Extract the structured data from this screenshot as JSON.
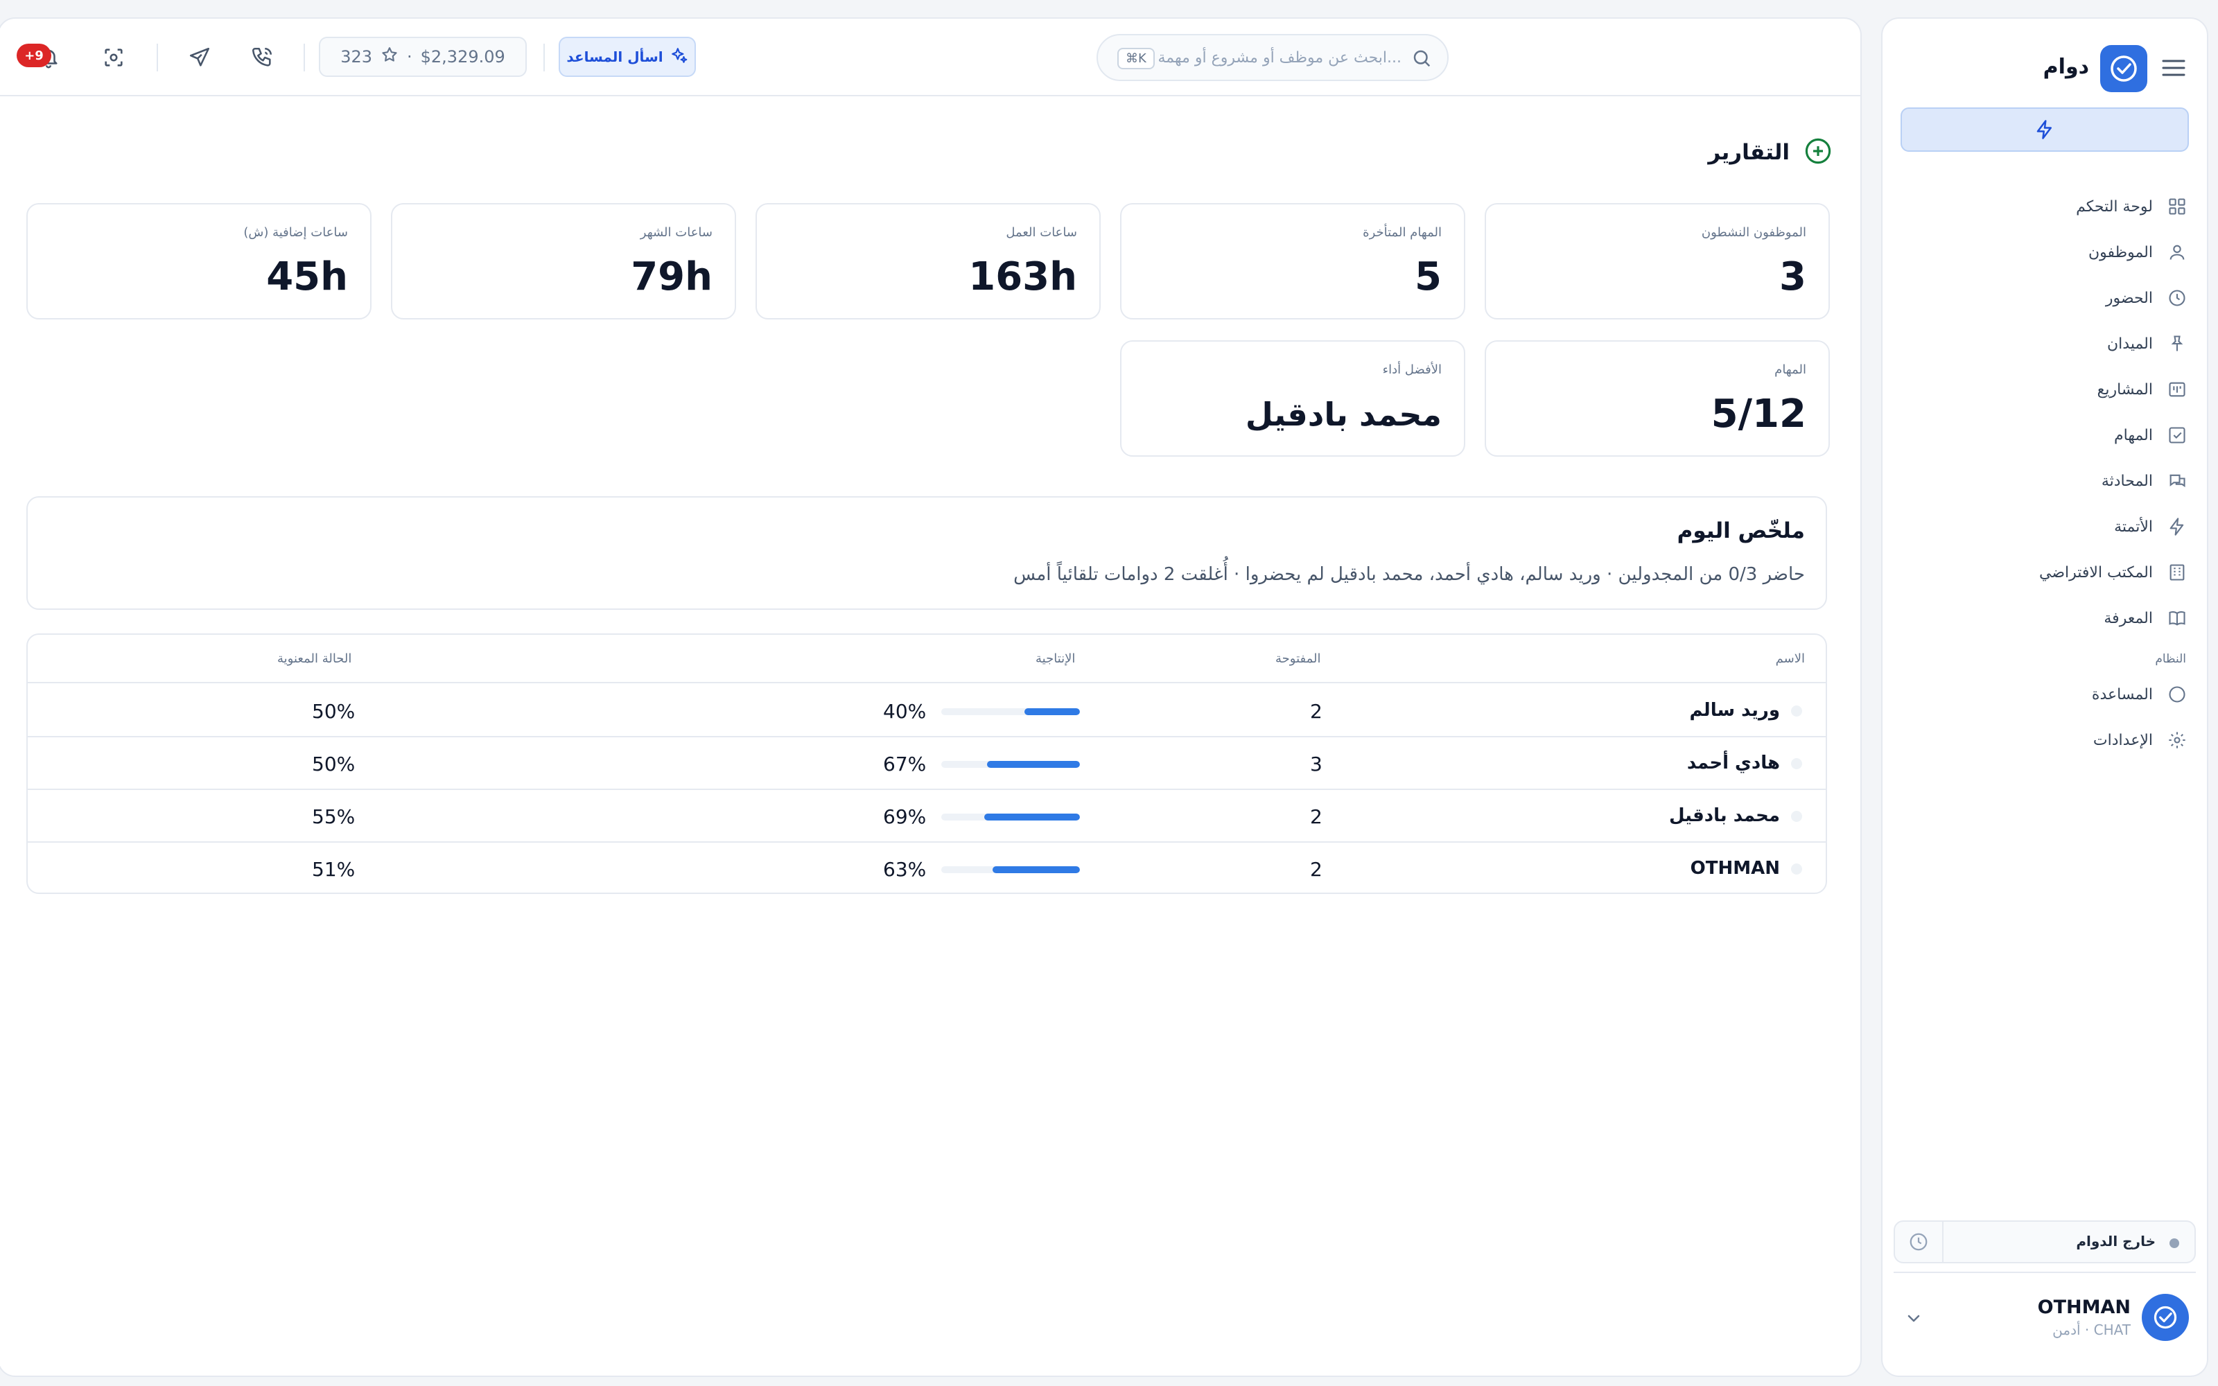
{
  "sidebar": {
    "brand": "دوام",
    "nav": [
      {
        "label": "لوحة التحكم",
        "icon": "dashboard-grid-icon"
      },
      {
        "label": "الموظفون",
        "icon": "user-icon"
      },
      {
        "label": "الحضور",
        "icon": "clock-icon"
      },
      {
        "label": "الميدان",
        "icon": "pin-icon"
      },
      {
        "label": "المشاريع",
        "icon": "kanban-icon"
      },
      {
        "label": "المهام",
        "icon": "check-square-icon"
      },
      {
        "label": "المحادثة",
        "icon": "chat-icon"
      },
      {
        "label": "الأتمتة",
        "icon": "lightning-icon"
      },
      {
        "label": "المكتب الافتراضي",
        "icon": "building-icon"
      },
      {
        "label": "المعرفة",
        "icon": "book-icon"
      }
    ],
    "system_section": "النظام",
    "system_nav": [
      {
        "label": "المساعدة",
        "icon": "circle-help-icon"
      },
      {
        "label": "الإعدادات",
        "icon": "gear-icon"
      }
    ],
    "status": "خارج الدوام",
    "user": {
      "name": "OTHMAN",
      "sub": "أدمن · CHAT"
    }
  },
  "topbar": {
    "search_placeholder": "ابحث عن موظف أو مشروع أو مهمة...",
    "search_shortcut": "⌘K",
    "assist_label": "اسأل المساعد",
    "credits_amount": "$2,329.09",
    "credits_points": "323",
    "notif_count": "+9"
  },
  "page": {
    "title": "التقارير"
  },
  "stats": [
    {
      "label": "الموظفون النشطون",
      "value": "3"
    },
    {
      "label": "المهام المتأخرة",
      "value": "5"
    },
    {
      "label": "ساعات العمل",
      "value": "163h"
    },
    {
      "label": "ساعات الشهر",
      "value": "79h"
    },
    {
      "label": "ساعات إضافية (ش)",
      "value": "45h"
    },
    {
      "label": "المهام",
      "value": "5/12"
    },
    {
      "label": "الأفضل أداء",
      "value": "محمد بادقيل"
    }
  ],
  "summary": {
    "title": "ملخّص اليوم",
    "text": "حاضر 0/3 من المجدولين · وريد سالم، هادي أحمد، محمد بادقيل لم يحضروا · أُغلقت 2 دوامات تلقائياً أمس"
  },
  "table": {
    "headers": {
      "name": "الاسم",
      "open": "المفتوحة",
      "productivity": "الإنتاجية",
      "mood": "الحالة المعنوية"
    },
    "rows": [
      {
        "name": "وريد سالم",
        "open": "2",
        "productivity": "40%",
        "productivity_value": 0.4,
        "mood": "50%"
      },
      {
        "name": "هادي أحمد",
        "open": "3",
        "productivity": "67%",
        "productivity_value": 0.67,
        "mood": "50%"
      },
      {
        "name": "محمد بادقيل",
        "open": "2",
        "productivity": "69%",
        "productivity_value": 0.69,
        "mood": "55%"
      },
      {
        "name": "OTHMAN",
        "open": "2",
        "productivity": "63%",
        "productivity_value": 0.63,
        "mood": "51%"
      }
    ]
  },
  "colors": {
    "accent": "#2f6fe0",
    "bar": "#2f7ae5",
    "badge": "#dc2626",
    "title_icon": "#15803d"
  }
}
